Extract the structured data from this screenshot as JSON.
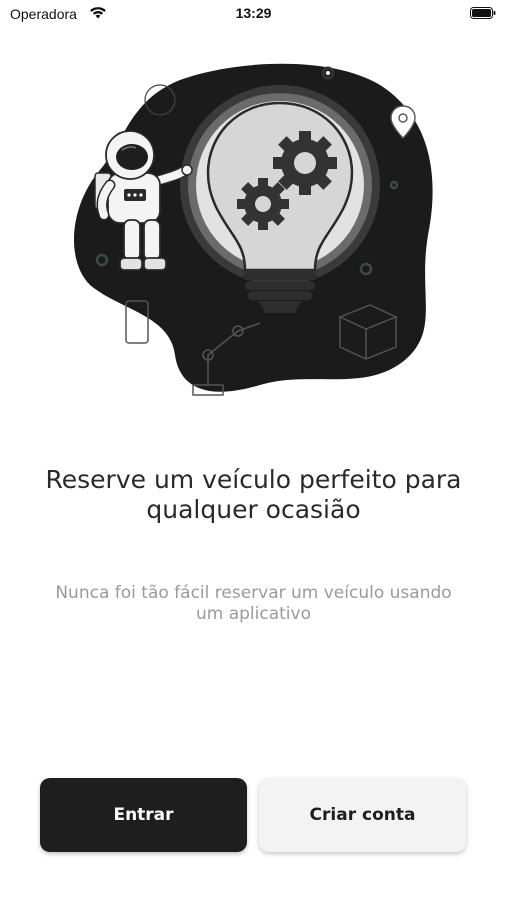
{
  "status_bar": {
    "carrier": "Operadora",
    "time": "13:29"
  },
  "illustration": {
    "icons": [
      "lightbulb-icon",
      "gear-icon",
      "astronaut-icon",
      "location-pin-icon",
      "robot-arm-icon",
      "box-icon",
      "phone-icon"
    ]
  },
  "onboarding": {
    "headline": "Reserve um veículo perfeito para qualquer ocasião",
    "subtitle": "Nunca foi tão fácil reservar um veículo usando um aplicativo"
  },
  "actions": {
    "login_label": "Entrar",
    "signup_label": "Criar conta"
  },
  "colors": {
    "primary": "#1e1e1e",
    "secondary_button": "#f3f3f3",
    "subtitle_text": "#9a9a9a"
  }
}
